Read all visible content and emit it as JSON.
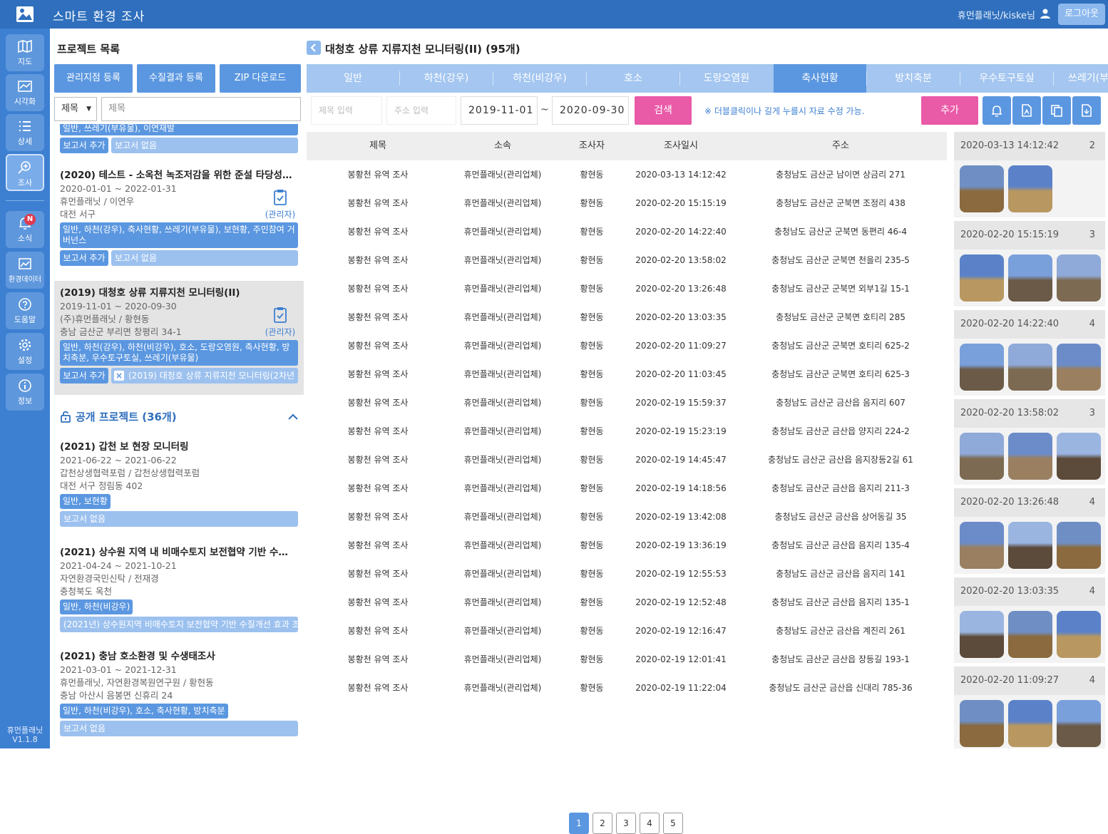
{
  "app": {
    "title": "스마트 환경 조사",
    "user": "휴먼플래닛/kiske님",
    "logout": "로그아웃"
  },
  "sidebar": {
    "items": [
      {
        "label": "지도",
        "icon": "map-icon"
      },
      {
        "label": "시각화",
        "icon": "chart-icon"
      },
      {
        "label": "상세",
        "icon": "list-icon"
      },
      {
        "label": "조사",
        "icon": "search-plus-icon"
      },
      {
        "label": "소식",
        "icon": "bell-icon",
        "badge": "N"
      },
      {
        "label": "환경데이터",
        "icon": "image-chart-icon"
      },
      {
        "label": "도움말",
        "icon": "help-icon"
      },
      {
        "label": "설정",
        "icon": "gear-icon"
      },
      {
        "label": "정보",
        "icon": "info-icon"
      }
    ],
    "version_name": "휴먼플래닛",
    "version": "V1.1.8"
  },
  "left": {
    "title": "프로젝트 목록",
    "buttons": [
      "관리지점 등록",
      "수질결과 등록",
      "ZIP 다운로드"
    ],
    "search_select": "제목",
    "search_placeholder": "제목",
    "top_partial_tags": "일반, 쓰레기(부유물), 이연재발",
    "top_add": "보고서 추가",
    "top_report": "보고서 없음",
    "projects": [
      {
        "title": "(2020) 테스트 - 소옥천 녹조저감을 위한 준설 타당성 조사…",
        "period": "2020-01-01 ~ 2022-01-31",
        "org": "휴먼플래닛 / 이연우",
        "addr": "대전 서구",
        "admin": "(관리자)",
        "tags": "일반, 하천(강우), 축사현황, 쓰레기(부유물), 보현황, 주민참여 거버넌스",
        "add": "보고서 추가",
        "report": "보고서 없음"
      },
      {
        "title": "(2019) 대청호 상류 지류지천 모니터링(II)",
        "period": "2019-11-01 ~ 2020-09-30",
        "org": "(주)휴먼플래닛 / 황현동",
        "addr": "충남 금산군 부리면 창평리 34-1",
        "admin": "(관리자)",
        "tags": "일반, 하천(강우), 하천(비강우), 호소, 도랑오염원, 축사현황, 방치축분, 우수토구토실, 쓰레기(부유물)",
        "add": "보고서 추가",
        "report": "(2019) 대청호 상류 지류지천 모니터링(2차년"
      }
    ],
    "public_title": "공개 프로젝트 (36개)",
    "public_projects": [
      {
        "title": "(2021) 갑천 보 현장 모니터링",
        "period": "2021-06-22 ~ 2021-06-22",
        "org": "갑천상생협력포럼 / 갑천상생협력포럼",
        "addr": "대전 서구 정림동 402",
        "tags": "일반, 보현황",
        "report": "보고서 없음"
      },
      {
        "title": "(2021) 상수원 지역 내 비매수토지 보전협약 기반 수질개…",
        "period": "2021-04-24 ~ 2021-10-21",
        "org": "자연환경국민신탁 / 전재경",
        "addr": "충청북도 옥천",
        "tags": "일반, 하천(비강우)",
        "report": "(2021년) 상수원지역 비매수토지 보전협약 기반 수질개선 효과 조"
      },
      {
        "title": "(2021) 충남 호소환경 및 수생태조사",
        "period": "2021-03-01 ~ 2021-12-31",
        "org": "휴먼플래닛, 자연환경복원연구원 / 황현동",
        "addr": "충남 아산시 음봉면 신휴리 24",
        "tags": "일반, 하천(비강우), 호소, 축사현황, 방치축분",
        "report": "보고서 없음"
      }
    ]
  },
  "main": {
    "title": "대청호 상류 지류지천 모니터링(II) (95개)",
    "tabs": [
      "일반",
      "하천(강우)",
      "하천(비강우)",
      "호소",
      "도랑오염원",
      "축사현황",
      "방치축분",
      "우수토구토실",
      "쓰레기(부"
    ],
    "active_tab": 5,
    "title_placeholder": "제목 입력",
    "addr_placeholder": "주소 입력",
    "date_from": "2019-11-01",
    "date_to": "2020-09-30",
    "tilde": "~",
    "search": "검색",
    "hint": "※ 더블클릭이나 길게 누를시 자료 수정 가능.",
    "add": "추가",
    "columns": [
      "제목",
      "소속",
      "조사자",
      "조사일시",
      "주소"
    ],
    "rows": [
      [
        "봉황천 유역 조사",
        "휴먼플래닛(관리업체)",
        "황현동",
        "2020-03-13 14:12:42",
        "충청남도 금산군 남이면 상금리 271"
      ],
      [
        "봉황천 유역 조사",
        "휴먼플래닛(관리업체)",
        "황현동",
        "2020-02-20 15:15:19",
        "충청남도 금산군 군북면 조정리 438"
      ],
      [
        "봉황천 유역 조사",
        "휴먼플래닛(관리업체)",
        "황현동",
        "2020-02-20 14:22:40",
        "충청남도 금산군 군북면 동편리 46-4"
      ],
      [
        "봉황천 유역 조사",
        "휴먼플래닛(관리업체)",
        "황현동",
        "2020-02-20 13:58:02",
        "충청남도 금산군 군북면 천을리 235-5"
      ],
      [
        "봉황천 유역 조사",
        "휴먼플래닛(관리업체)",
        "황현동",
        "2020-02-20 13:26:48",
        "충청남도 금산군 군북면 외부1길 15-1"
      ],
      [
        "봉황천 유역 조사",
        "휴먼플래닛(관리업체)",
        "황현동",
        "2020-02-20 13:03:35",
        "충청남도 금산군 군북면 호티리 285"
      ],
      [
        "봉황천 유역 조사",
        "휴먼플래닛(관리업체)",
        "황현동",
        "2020-02-20 11:09:27",
        "충청남도 금산군 군북면 호티리 625-2"
      ],
      [
        "봉황천 유역 조사",
        "휴먼플래닛(관리업체)",
        "황현동",
        "2020-02-20 11:03:45",
        "충청남도 금산군 군북면 호티리 625-3"
      ],
      [
        "봉황천 유역 조사",
        "휴먼플래닛(관리업체)",
        "황현동",
        "2020-02-19 15:59:37",
        "충청남도 금산군 금산읍 음지리 607"
      ],
      [
        "봉황천 유역 조사",
        "휴먼플래닛(관리업체)",
        "황현동",
        "2020-02-19 15:23:19",
        "충청남도 금산군 금산읍 양지리 224-2"
      ],
      [
        "봉황천 유역 조사",
        "휴먼플래닛(관리업체)",
        "황현동",
        "2020-02-19 14:45:47",
        "충청남도 금산군 금산읍 음지장등2길 61"
      ],
      [
        "봉황천 유역 조사",
        "휴먼플래닛(관리업체)",
        "황현동",
        "2020-02-19 14:18:56",
        "충청남도 금산군 금산읍 음지리 211-3"
      ],
      [
        "봉황천 유역 조사",
        "휴먼플래닛(관리업체)",
        "황현동",
        "2020-02-19 13:42:08",
        "충청남도 금산군 금산읍 상어동길 35"
      ],
      [
        "봉황천 유역 조사",
        "휴먼플래닛(관리업체)",
        "황현동",
        "2020-02-19 13:36:19",
        "충청남도 금산군 금산읍 음지리 135-4"
      ],
      [
        "봉황천 유역 조사",
        "휴먼플래닛(관리업체)",
        "황현동",
        "2020-02-19 12:55:53",
        "충청남도 금산군 금산읍 음지리 141"
      ],
      [
        "봉황천 유역 조사",
        "휴먼플래닛(관리업체)",
        "황현동",
        "2020-02-19 12:52:48",
        "충청남도 금산군 금산읍 음지리 135-1"
      ],
      [
        "봉황천 유역 조사",
        "휴먼플래닛(관리업체)",
        "황현동",
        "2020-02-19 12:16:47",
        "충청남도 금산군 금산읍 계진리 261"
      ],
      [
        "봉황천 유역 조사",
        "휴먼플래닛(관리업체)",
        "황현동",
        "2020-02-19 12:01:41",
        "충청남도 금산군 금산읍 장등길 193-1"
      ],
      [
        "봉황천 유역 조사",
        "휴먼플래닛(관리업체)",
        "황현동",
        "2020-02-19 11:22:04",
        "충청남도 금산군 금산읍 신대리 785-36"
      ]
    ],
    "pages": [
      "1",
      "2",
      "3",
      "4",
      "5"
    ],
    "active_page": 0
  },
  "photos": [
    {
      "date": "2020-03-13 14:12:42",
      "count": "2",
      "thumbs": 2
    },
    {
      "date": "2020-02-20 15:15:19",
      "count": "3",
      "thumbs": 3
    },
    {
      "date": "2020-02-20 14:22:40",
      "count": "4",
      "thumbs": 3
    },
    {
      "date": "2020-02-20 13:58:02",
      "count": "3",
      "thumbs": 3
    },
    {
      "date": "2020-02-20 13:26:48",
      "count": "4",
      "thumbs": 3
    },
    {
      "date": "2020-02-20 13:03:35",
      "count": "4",
      "thumbs": 3
    },
    {
      "date": "2020-02-20 11:09:27",
      "count": "4",
      "thumbs": 3
    }
  ],
  "colors": {
    "primary": "#2f6fbd",
    "tab": "#a4c6f0",
    "tab_active": "#5b97e0",
    "accent": "#e95aa7"
  }
}
